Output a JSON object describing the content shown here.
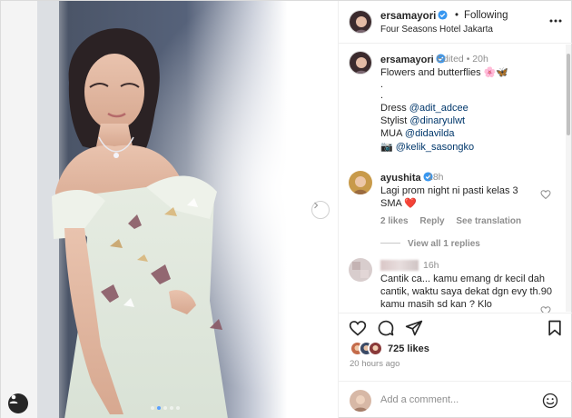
{
  "post": {
    "username": "ersamayori",
    "follow_separator": "•",
    "follow_status": "Following",
    "location": "Four Seasons Hotel Jakarta",
    "carousel": {
      "slide_count": 5,
      "active_index": 1
    }
  },
  "caption": {
    "username": "ersamayori",
    "meta": "Edited • 20h",
    "title": "Flowers and butterflies 🌸🦋",
    "dot1": ".",
    "dot2": ".",
    "dress_label": "Dress ",
    "dress_mention": "@adit_adcee",
    "stylist_label": "Stylist ",
    "stylist_mention": "@dinaryulwt",
    "mua_label": "MUA ",
    "mua_mention": "@didavilda",
    "camera_glyph": "📷",
    "camera_mention": " @kelik_sasongko"
  },
  "comments": [
    {
      "username": "ayushita",
      "time": "18h",
      "text": "Lagi prom night ni pasti kelas 3 SMA ❤️",
      "likes": "2 likes",
      "reply": "Reply",
      "translation": "See translation",
      "view_replies": "View all 1 replies"
    },
    {
      "time": "16h",
      "text": "Cantik ca... kamu emang dr kecil dah cantik, waktu saya dekat dgn evy th.90 kamu masih sd kan ? Klo"
    }
  ],
  "likes": {
    "count_label": "725 likes"
  },
  "timestamp": "20 hours ago",
  "add_comment": {
    "placeholder": "Add a comment..."
  },
  "colors": {
    "verified": "#3897f0",
    "link": "#00376b",
    "heart": "#e0245e",
    "muted": "#8e8e8e"
  }
}
